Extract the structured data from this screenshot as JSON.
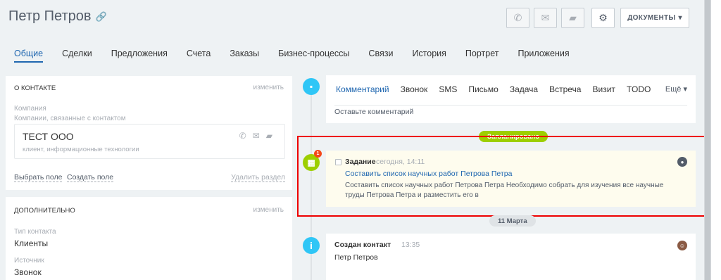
{
  "header": {
    "title": "Петр Петров",
    "docs_label": "ДОКУМЕНТЫ",
    "icons": [
      "phone-icon",
      "mail-icon",
      "chat-icon",
      "gear-icon"
    ]
  },
  "tabs": [
    "Общие",
    "Сделки",
    "Предложения",
    "Счета",
    "Заказы",
    "Бизнес-процессы",
    "Связи",
    "История",
    "Портрет",
    "Приложения"
  ],
  "about": {
    "title": "О КОНТАКТЕ",
    "edit": "изменить",
    "company_label": "Компания",
    "company_sub": "Компании, связанные с контактом",
    "company_name": "ТЕСТ ООО",
    "company_desc": "клиент, информационные технологии",
    "select_field": "Выбрать поле",
    "create_field": "Создать поле",
    "delete_section": "Удалить раздел"
  },
  "extra": {
    "title": "ДОПОЛНИТЕЛЬНО",
    "edit": "изменить",
    "type_label": "Тип контакта",
    "type_value": "Клиенты",
    "source_label": "Источник",
    "source_value": "Звонок"
  },
  "editor": {
    "tabs": [
      "Комментарий",
      "Звонок",
      "SMS",
      "Письмо",
      "Задача",
      "Встреча",
      "Визит",
      "TODO"
    ],
    "more": "Ещё",
    "placeholder": "Оставьте комментарий"
  },
  "planned_label": "Запланировано",
  "task": {
    "type": "Задание",
    "time": "сегодня, 14:11",
    "title": "Составить список научных работ Петрова Петра",
    "description": "Составить список научных работ Петрова Петра Необходимо собрать для изучения все научные труды Петрова Петра и разместить его в",
    "badge": "1"
  },
  "date_label": "11 Марта",
  "created": {
    "label": "Создан контакт",
    "time": "13:35",
    "name": "Петр Петров"
  },
  "colors": {
    "accent": "#2067b0",
    "green": "#9dcf00",
    "blue": "#2fc6f6",
    "highlight": "#e00000"
  }
}
